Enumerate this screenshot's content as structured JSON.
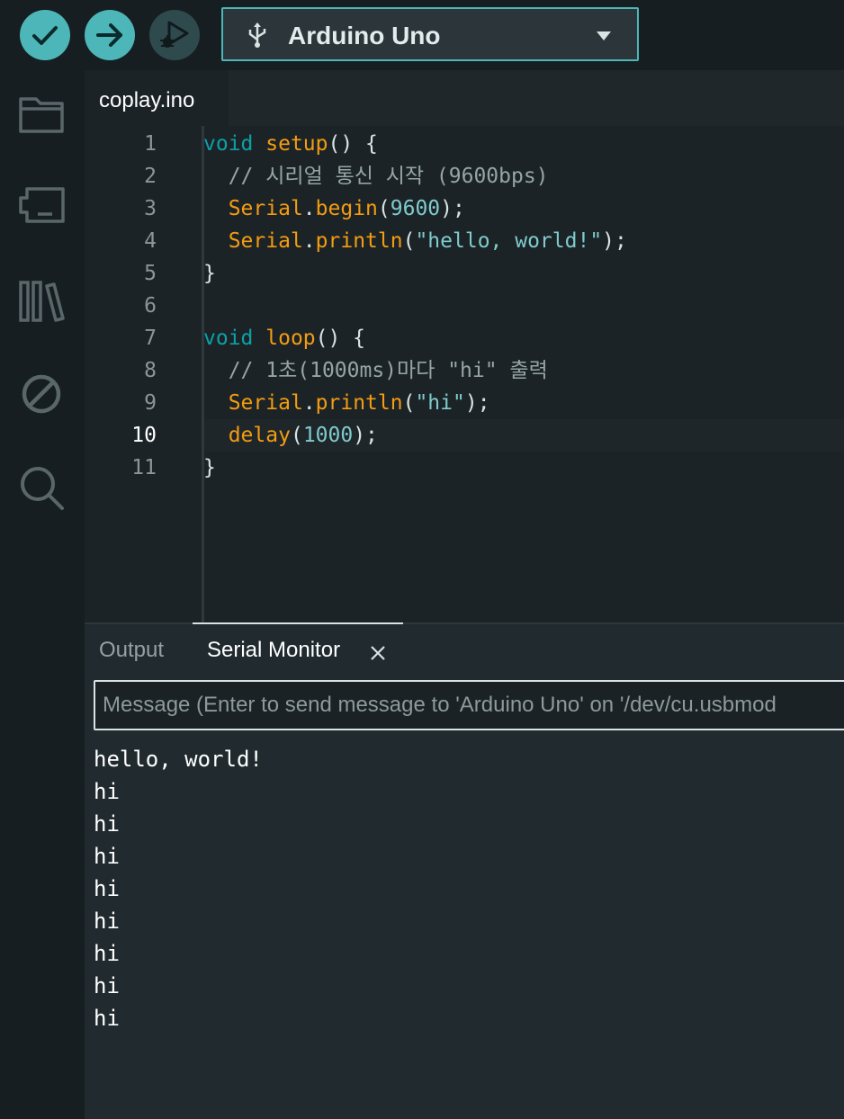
{
  "toolbar": {
    "verify_icon": "check-icon",
    "upload_icon": "arrow-right-icon",
    "debug_icon": "debug-icon",
    "board": {
      "icon": "usb-icon",
      "name": "Arduino Uno"
    }
  },
  "sidebar": {
    "items": [
      {
        "name": "sketchbook",
        "icon": "folder-icon"
      },
      {
        "name": "boards-manager",
        "icon": "board-icon"
      },
      {
        "name": "library-manager",
        "icon": "library-icon"
      },
      {
        "name": "debug",
        "icon": "no-entry-icon"
      },
      {
        "name": "search",
        "icon": "search-icon"
      }
    ]
  },
  "editor": {
    "tab_label": "coplay.ino",
    "active_line": 10,
    "lines": [
      {
        "no": "1",
        "tokens": [
          [
            "k",
            "void"
          ],
          [
            "p",
            " "
          ],
          [
            "f",
            "setup"
          ],
          [
            "p",
            "() {"
          ]
        ]
      },
      {
        "no": "2",
        "tokens": [
          [
            "p",
            "  "
          ],
          [
            "c",
            "// 시리얼 통신 시작 (9600bps)"
          ]
        ]
      },
      {
        "no": "3",
        "tokens": [
          [
            "p",
            "  "
          ],
          [
            "f",
            "Serial"
          ],
          [
            "p",
            "."
          ],
          [
            "f",
            "begin"
          ],
          [
            "p",
            "("
          ],
          [
            "n",
            "9600"
          ],
          [
            "p",
            ");"
          ]
        ]
      },
      {
        "no": "4",
        "tokens": [
          [
            "p",
            "  "
          ],
          [
            "f",
            "Serial"
          ],
          [
            "p",
            "."
          ],
          [
            "f",
            "println"
          ],
          [
            "p",
            "("
          ],
          [
            "s",
            "\"hello, world!\""
          ],
          [
            "p",
            ");"
          ]
        ]
      },
      {
        "no": "5",
        "tokens": [
          [
            "p",
            "}"
          ]
        ]
      },
      {
        "no": "6",
        "tokens": []
      },
      {
        "no": "7",
        "tokens": [
          [
            "k",
            "void"
          ],
          [
            "p",
            " "
          ],
          [
            "f",
            "loop"
          ],
          [
            "p",
            "() {"
          ]
        ]
      },
      {
        "no": "8",
        "tokens": [
          [
            "p",
            "  "
          ],
          [
            "c",
            "// 1초(1000ms)마다 \"hi\" 출력"
          ]
        ]
      },
      {
        "no": "9",
        "tokens": [
          [
            "p",
            "  "
          ],
          [
            "f",
            "Serial"
          ],
          [
            "p",
            "."
          ],
          [
            "f",
            "println"
          ],
          [
            "p",
            "("
          ],
          [
            "s",
            "\"hi\""
          ],
          [
            "p",
            ");"
          ]
        ]
      },
      {
        "no": "10",
        "tokens": [
          [
            "p",
            "  "
          ],
          [
            "f",
            "delay"
          ],
          [
            "p",
            "("
          ],
          [
            "n",
            "1000"
          ],
          [
            "p",
            ");"
          ]
        ]
      },
      {
        "no": "11",
        "tokens": [
          [
            "p",
            "}"
          ]
        ]
      }
    ]
  },
  "panel": {
    "tabs": {
      "output": "Output",
      "serial_monitor": "Serial Monitor"
    },
    "close_icon": "close-icon",
    "message_placeholder": "Message (Enter to send message to 'Arduino Uno' on '/dev/cu.usbmod",
    "serial_output": [
      "hello, world!",
      "hi",
      "hi",
      "hi",
      "hi",
      "hi",
      "hi",
      "hi",
      "hi"
    ]
  },
  "colors": {
    "accent": "#4db6b8",
    "keyword": "#0ca1a6",
    "function": "#f39c12",
    "string": "#7fcbcd",
    "comment": "#95a5a6"
  }
}
